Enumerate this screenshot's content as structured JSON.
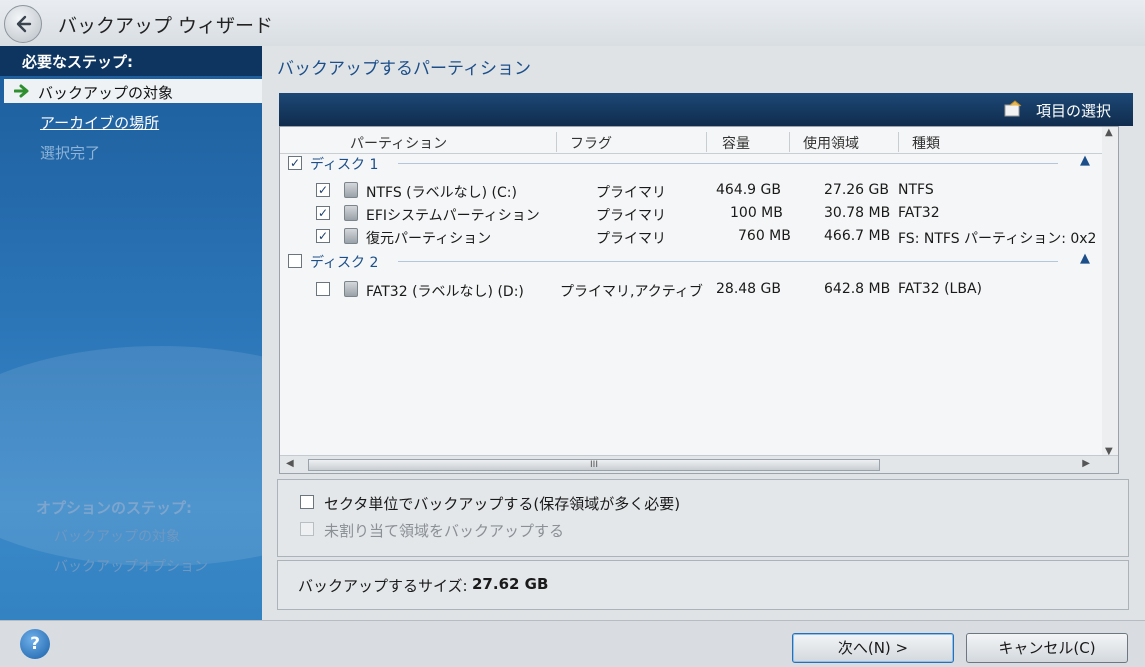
{
  "window": {
    "title": "バックアップ ウィザード"
  },
  "sidebar": {
    "required_heading": "必要なステップ:",
    "steps": [
      {
        "label": "バックアップの対象",
        "state": "current"
      },
      {
        "label": "アーカイブの場所",
        "state": "link"
      },
      {
        "label": "選択完了",
        "state": "disabled"
      }
    ],
    "optional_heading": "オプションのステップ:",
    "optional_steps": [
      "バックアップの対象",
      "バックアップオプション"
    ]
  },
  "main": {
    "title": "バックアップするパーティション",
    "toolbar": {
      "select_items_label": "項目の選択",
      "select_items_icon": "select-items-icon"
    },
    "columns": [
      "パーティション",
      "フラグ",
      "容量",
      "使用領域",
      "種類"
    ],
    "disks": [
      {
        "label": "ディスク 1",
        "checked": true,
        "partitions": [
          {
            "name": "NTFS (ラベルなし) (C:)",
            "flag": "プライマリ",
            "capacity": "464.9 GB",
            "used": "27.26 GB",
            "type": "NTFS",
            "checked": true
          },
          {
            "name": "EFIシステムパーティション",
            "flag": "プライマリ",
            "capacity": "100 MB",
            "used": "30.78 MB",
            "type": "FAT32",
            "checked": true
          },
          {
            "name": "復元パーティション",
            "flag": "プライマリ",
            "capacity": "760 MB",
            "used": "466.7 MB",
            "type": "FS: NTFS パーティション: 0x2",
            "checked": true
          }
        ]
      },
      {
        "label": "ディスク 2",
        "checked": false,
        "partitions": [
          {
            "name": "FAT32 (ラベルなし) (D:)",
            "flag": "プライマリ,アクティブ",
            "capacity": "28.48 GB",
            "used": "642.8 MB",
            "type": "FAT32 (LBA)",
            "checked": false
          }
        ]
      }
    ],
    "scrollbar_thumb_label": "III",
    "options": {
      "sector_backup": "セクタ単位でバックアップする(保存領域が多く必要)",
      "unallocated_backup": "未割り当て領域をバックアップする"
    },
    "size": {
      "label": "バックアップするサイズ:",
      "value": "27.62 GB"
    }
  },
  "footer": {
    "help_label": "?",
    "next_label": "次へ(N) >",
    "cancel_label": "キャンセル(C)"
  },
  "colors": {
    "sidebar": "#2a74b6",
    "sidebar_heading": "#0d3560",
    "accent_text": "#1c4f8a"
  }
}
